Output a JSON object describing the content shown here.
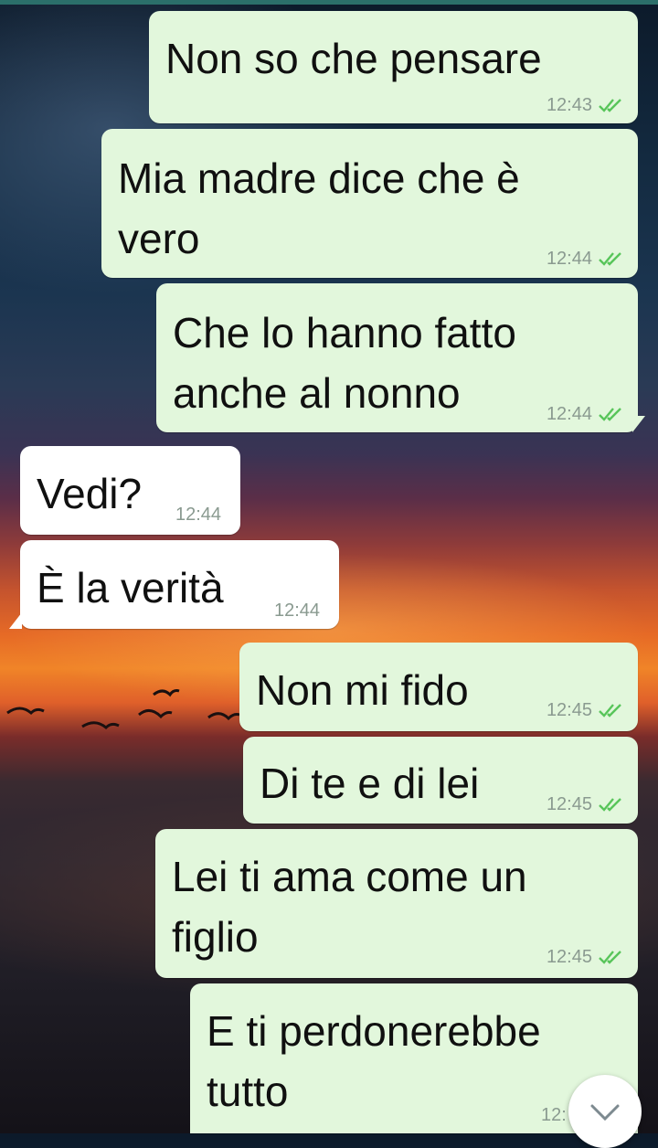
{
  "messages": [
    {
      "direction": "outgoing",
      "lines": [
        "Non so che pensare"
      ],
      "time": "12:43",
      "status": "read"
    },
    {
      "direction": "outgoing",
      "lines": [
        "Mia madre dice che è",
        "vero"
      ],
      "time": "12:44",
      "status": "read"
    },
    {
      "direction": "outgoing",
      "lines": [
        "Che lo hanno fatto",
        "anche al nonno"
      ],
      "time": "12:44",
      "status": "read"
    },
    {
      "direction": "incoming",
      "lines": [
        "Vedi?"
      ],
      "time": "12:44"
    },
    {
      "direction": "incoming",
      "lines": [
        "È la verità"
      ],
      "time": "12:44"
    },
    {
      "direction": "outgoing",
      "lines": [
        "Non mi fido"
      ],
      "time": "12:45",
      "status": "read"
    },
    {
      "direction": "outgoing",
      "lines": [
        "Di te e di lei"
      ],
      "time": "12:45",
      "status": "read"
    },
    {
      "direction": "outgoing",
      "lines": [
        "Lei ti ama come un",
        "figlio"
      ],
      "time": "12:45",
      "status": "read"
    },
    {
      "direction": "outgoing",
      "lines": [
        "E ti perdonerebbe",
        "tutto"
      ],
      "time": "12:"
    }
  ],
  "colors": {
    "outgoing_bubble": "#e2f7dc",
    "incoming_bubble": "#ffffff",
    "read_ticks": "#4fc3f7",
    "timestamp": "#8a9a90"
  },
  "icons": {
    "read_status": "double-check-icon",
    "scroll_down": "chevron-down-icon"
  }
}
